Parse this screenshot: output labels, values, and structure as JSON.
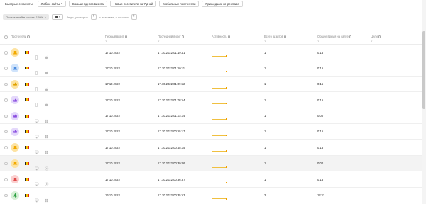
{
  "segments": {
    "label": "Быстрые сегменты",
    "chips": [
      {
        "label": "Любые сайты",
        "dropdown": true
      },
      {
        "label": "Больше одного визита",
        "dropdown": false
      },
      {
        "label": "Новые посетители за 7 дней",
        "dropdown": false
      },
      {
        "label": "Мобильные посетители",
        "dropdown": false
      },
      {
        "label": "Пришедшие по рекламе",
        "dropdown": false
      }
    ]
  },
  "filters": {
    "active": "Посетителей в отчёте: 100%",
    "who_placeholder": "Люди, у которых",
    "visits_placeholder": "с визитами, в которых"
  },
  "table": {
    "columns": {
      "visitors": "Посетители",
      "first_visit": "Первый визит",
      "last_visit": "Последний визит",
      "activity": "Активность",
      "total_visits": "Всего визитов",
      "total_time": "Общее время на сайте",
      "goals": "Цели"
    },
    "filter_glyph": "⊽",
    "rows": [
      {
        "avatar_color": "#fde3a2",
        "icon_color": "#f2a900",
        "icon": "hat-icon",
        "device": "phone-icon",
        "os": "apple-icon",
        "first": "17.10.2022",
        "last": "17.10.2022 01:19:41",
        "visits": "1",
        "time": "0:16",
        "hl": false
      },
      {
        "avatar_color": "#cfe3fb",
        "icon_color": "#4c8de0",
        "icon": "hat-icon",
        "device": "phone-icon",
        "os": "apple-icon",
        "first": "17.10.2022",
        "last": "17.10.2022 01:10:11",
        "visits": "1",
        "time": "0:15",
        "hl": false
      },
      {
        "avatar_color": "#fde3a2",
        "icon_color": "#e0a100",
        "icon": "crown-icon",
        "device": "phone-icon",
        "os": "apple-icon",
        "first": "17.10.2022",
        "last": "17.10.2022 01:09:52",
        "visits": "1",
        "time": "0:15",
        "hl": false
      },
      {
        "avatar_color": "#e4d8fb",
        "icon_color": "#8a4fe0",
        "icon": "crown-icon",
        "device": "phone-icon",
        "os": "apple-icon",
        "first": "17.10.2022",
        "last": "17.10.2022 01:08:54",
        "visits": "1",
        "time": "0:15",
        "hl": false
      },
      {
        "avatar_color": "#e4d8fb",
        "icon_color": "#8a4fe0",
        "icon": "crown-icon",
        "device": "desktop-icon",
        "os": "windows-icon",
        "first": "17.10.2022",
        "last": "17.10.2022 01:03:14",
        "visits": "1",
        "time": "0:00",
        "hl": false
      },
      {
        "avatar_color": "#e4d8fb",
        "icon_color": "#8a4fe0",
        "icon": "crown-icon",
        "device": "desktop-icon",
        "os": "windows-icon",
        "first": "17.10.2022",
        "last": "17.10.2022 00:55:17",
        "visits": "1",
        "time": "0:15",
        "hl": false
      },
      {
        "avatar_color": "#fde3a2",
        "icon_color": "#f2a900",
        "icon": "hat-icon",
        "device": "desktop-icon",
        "os": "windows-icon",
        "first": "17.10.2022",
        "last": "17.10.2022 00:48:15",
        "visits": "1",
        "time": "0:15",
        "hl": false
      },
      {
        "avatar_color": "#fde3a2",
        "icon_color": "#f2a900",
        "icon": "hat-icon",
        "device": "desktop-icon",
        "os": "chrome-icon",
        "first": "17.10.2022",
        "last": "17.10.2022 00:39:06",
        "visits": "1",
        "time": "0:00",
        "hl": true
      },
      {
        "avatar_color": "#fbd0d0",
        "icon_color": "#e04c4c",
        "icon": "hat-icon",
        "device": "desktop-icon",
        "os": "chrome-icon",
        "first": "17.10.2022",
        "last": "17.10.2022 00:36:37",
        "visits": "1",
        "time": "0:15",
        "hl": false
      },
      {
        "avatar_color": "#d6f0d6",
        "icon_color": "#2ea043",
        "icon": "tree-icon",
        "device": "desktop-icon",
        "os": "windows-icon",
        "first": "16.10.2022",
        "last": "17.10.2022 00:35:53",
        "visits": "2",
        "time": "12:11",
        "hl": false
      }
    ]
  },
  "flag": {
    "colors": [
      "#222222",
      "#f2c200",
      "#e02020"
    ]
  }
}
